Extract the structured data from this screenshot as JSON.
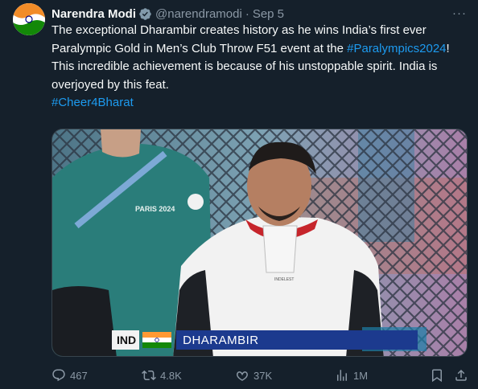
{
  "author": {
    "name": "Narendra Modi",
    "handle": "@narendramodi",
    "separator": "·",
    "date": "Sep 5",
    "verified_icon": "verified-badge-icon",
    "more_label": "···"
  },
  "tweet": {
    "text_before": "The exceptional Dharambir creates history as he wins India’s first ever Paralympic Gold in Men’s Club Throw F51 event at the ",
    "hashtag_inline": "#Paralympics2024",
    "text_after": "! This incredible achievement is because of his unstoppable spirit. India is overjoyed by this feat.",
    "hashtag_footer": "#Cheer4Bharat"
  },
  "media": {
    "lower_third_country": "IND",
    "lower_third_name": "DHARAMBIR",
    "bib_text": "PARIS 2024",
    "jacket_text": "INDELEST"
  },
  "actions": {
    "replies": "467",
    "reposts": "4.8K",
    "likes": "37K",
    "views": "1M"
  },
  "colors": {
    "background": "#15202b",
    "text": "#f7f9f9",
    "secondary": "#8b98a5",
    "link": "#1d9bf0",
    "verified": "#829aab"
  }
}
